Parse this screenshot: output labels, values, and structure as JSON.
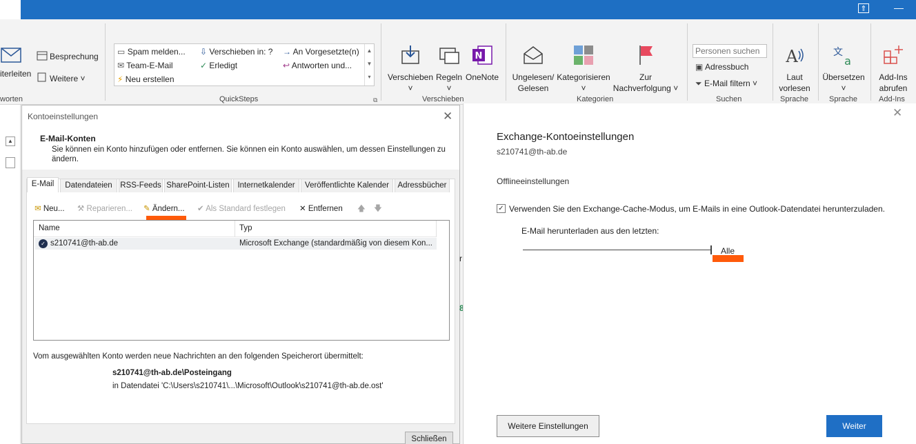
{
  "ribbon": {
    "respond_partial": "iterleiten",
    "respond_group": "worten",
    "meeting": "Besprechung",
    "more": "Weitere",
    "quicksteps": [
      "Spam melden...",
      "Team-E-Mail",
      "Neu erstellen",
      "Verschieben in: ?",
      "Erledigt",
      "An Vorgesetzte(n)",
      "Antworten und..."
    ],
    "quicksteps_group": "QuickSteps",
    "move": "Verschieben",
    "rules": "Regeln",
    "onenote": "OneNote",
    "move_group": "Verschieben",
    "unread_read": [
      "Ungelesen/",
      "Gelesen"
    ],
    "categorize": "Kategorisieren",
    "followup": [
      "Zur",
      "Nachverfolgung"
    ],
    "tags_group": "Kategorien",
    "search_people_placeholder": "Personen suchen",
    "address_book": "Adressbuch",
    "filter_email": "E-Mail filtern",
    "find_group": "Suchen",
    "read_aloud": [
      "Laut",
      "vorlesen"
    ],
    "speech_group": "Sprache",
    "translate": "Übersetzen",
    "language_group": "Sprache",
    "addins": [
      "Add-Ins",
      "abrufen"
    ],
    "addins_group": "Add-Ins"
  },
  "dialog": {
    "title": "Kontoeinstellungen",
    "heading": "E-Mail-Konten",
    "description": "Sie können ein Konto hinzufügen oder entfernen. Sie können ein Konto auswählen, um dessen Einstellungen zu ändern.",
    "tabs": [
      "E-Mail",
      "Datendateien",
      "RSS-Feeds",
      "SharePoint-Listen",
      "Internetkalender",
      "Veröffentlichte Kalender",
      "Adressbücher"
    ],
    "toolbar": {
      "new": "Neu...",
      "repair": "Reparieren...",
      "change": "Ändern...",
      "set_default": "Als Standard festlegen",
      "remove": "Entfernen"
    },
    "columns": [
      "Name",
      "Typ"
    ],
    "rows": [
      {
        "name": "s210741@th-ab.de",
        "type": "Microsoft Exchange (standardmäßig von diesem Kon..."
      }
    ],
    "delivery_text": "Vom ausgewählten Konto werden neue Nachrichten an den folgenden Speicherort übermittelt:",
    "delivery_location": "s210741@th-ab.de\\Posteingang",
    "delivery_file": "in Datendatei 'C:\\Users\\s210741\\...\\Microsoft\\Outlook\\s210741@th-ab.de.ost'",
    "close": "Schließen"
  },
  "exchange": {
    "title": "Exchange-Kontoeinstellungen",
    "email": "s210741@th-ab.de",
    "offline_heading": "Offlineeinstellungen",
    "cache_mode_label": "Verwenden Sie den Exchange-Cache-Modus, um E-Mails in eine Outlook-Datendatei herunterzuladen.",
    "cache_mode_checked": true,
    "download_label": "E-Mail herunterladen aus den letzten:",
    "download_value": "Alle",
    "more_settings": "Weitere Einstellungen",
    "next": "Weiter"
  },
  "colors": {
    "titlebar": "#1e6fc3",
    "accent_button": "#1f6fc5",
    "highlight": "#ff5a0a"
  }
}
